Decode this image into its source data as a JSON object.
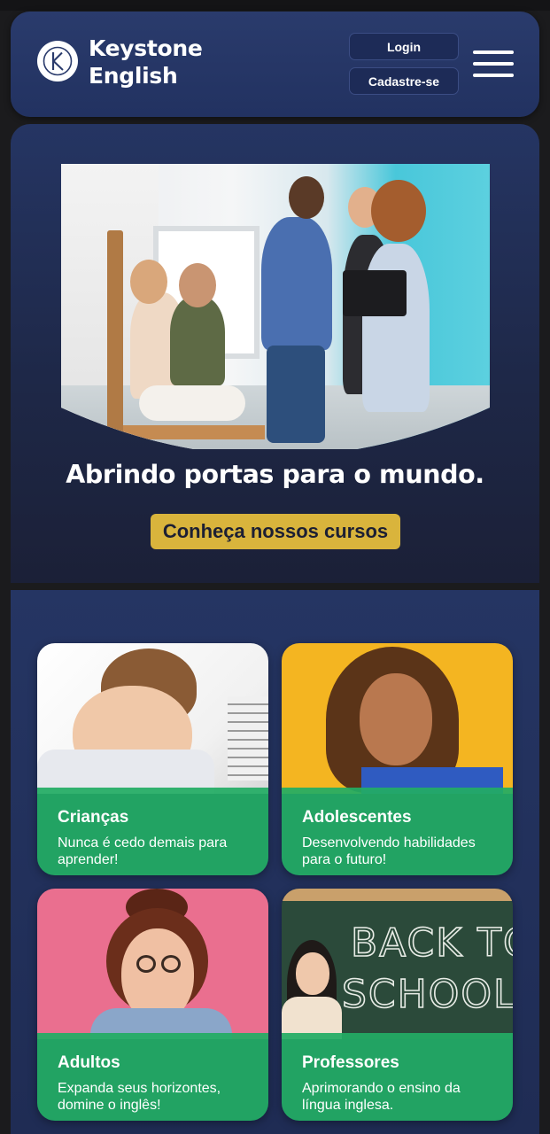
{
  "header": {
    "brand_line1": "Keystone",
    "brand_line2": "English",
    "login_label": "Login",
    "signup_label": "Cadastre-se"
  },
  "hero": {
    "title": "Abrindo portas para o mundo.",
    "cta_label": "Conheça nossos cursos"
  },
  "courses": [
    {
      "title": "Crianças",
      "description": "Nunca é cedo demais para aprender!"
    },
    {
      "title": "Adolescentes",
      "description": "Desenvolvendo habilidades para o futuro!"
    },
    {
      "title": "Adultos",
      "description": "Expanda seus horizontes, domine o inglês!"
    },
    {
      "title": "Professores",
      "description": "Aprimorando o ensino da língua inglesa."
    }
  ],
  "chalkboard_text": [
    "BACK TO",
    "SCHOOL"
  ],
  "colors": {
    "navy": "#253563",
    "gold": "#d9b43c",
    "green": "#22ac64",
    "background": "#1b1b1d"
  },
  "icons": {
    "logo": "k-logo-icon",
    "menu": "hamburger-menu-icon"
  }
}
